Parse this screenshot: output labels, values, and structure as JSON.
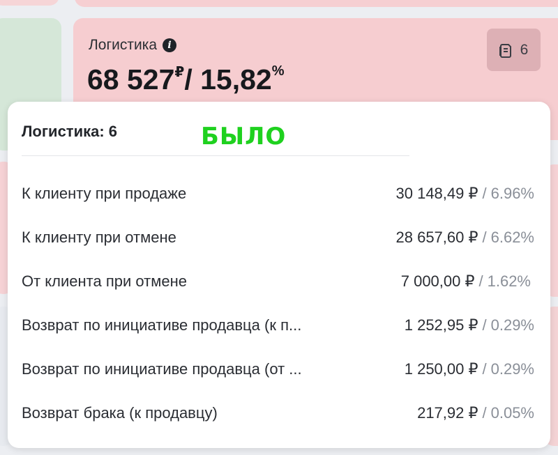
{
  "card": {
    "title": "Логистика",
    "total_amount": "68 527",
    "total_currency": "₽",
    "total_separator": "/ 15,82",
    "total_percent_sign": "%",
    "docs_count": "6",
    "icons": {
      "info": "info-icon",
      "docs": "document-icon"
    }
  },
  "popover": {
    "title": "Логистика: 6",
    "note": "БЫЛО",
    "rows": [
      {
        "label": "К клиенту при продаже",
        "amount": "30 148,49 ₽",
        "sep": "/",
        "percent": "6.96%"
      },
      {
        "label": "К клиенту при отмене",
        "amount": "28 657,60 ₽",
        "sep": "/",
        "percent": "6.62%"
      },
      {
        "label": "От клиента при отмене",
        "amount": "7 000,00 ₽",
        "sep": "/",
        "percent": "1.62%"
      },
      {
        "label": "Возврат по инициативе продавца (к п...",
        "amount": "1 252,95 ₽",
        "sep": "/",
        "percent": "0.29%"
      },
      {
        "label": "Возврат по инициативе продавца (от ...",
        "amount": "1 250,00 ₽",
        "sep": "/",
        "percent": "0.29%"
      },
      {
        "label": "Возврат брака (к продавцу)",
        "amount": "217,92 ₽",
        "sep": "/",
        "percent": "0.05%"
      }
    ]
  },
  "colors": {
    "card_bg": "#f6cdd0",
    "note": "#1fd11f",
    "muted_text": "#8a8f98"
  }
}
